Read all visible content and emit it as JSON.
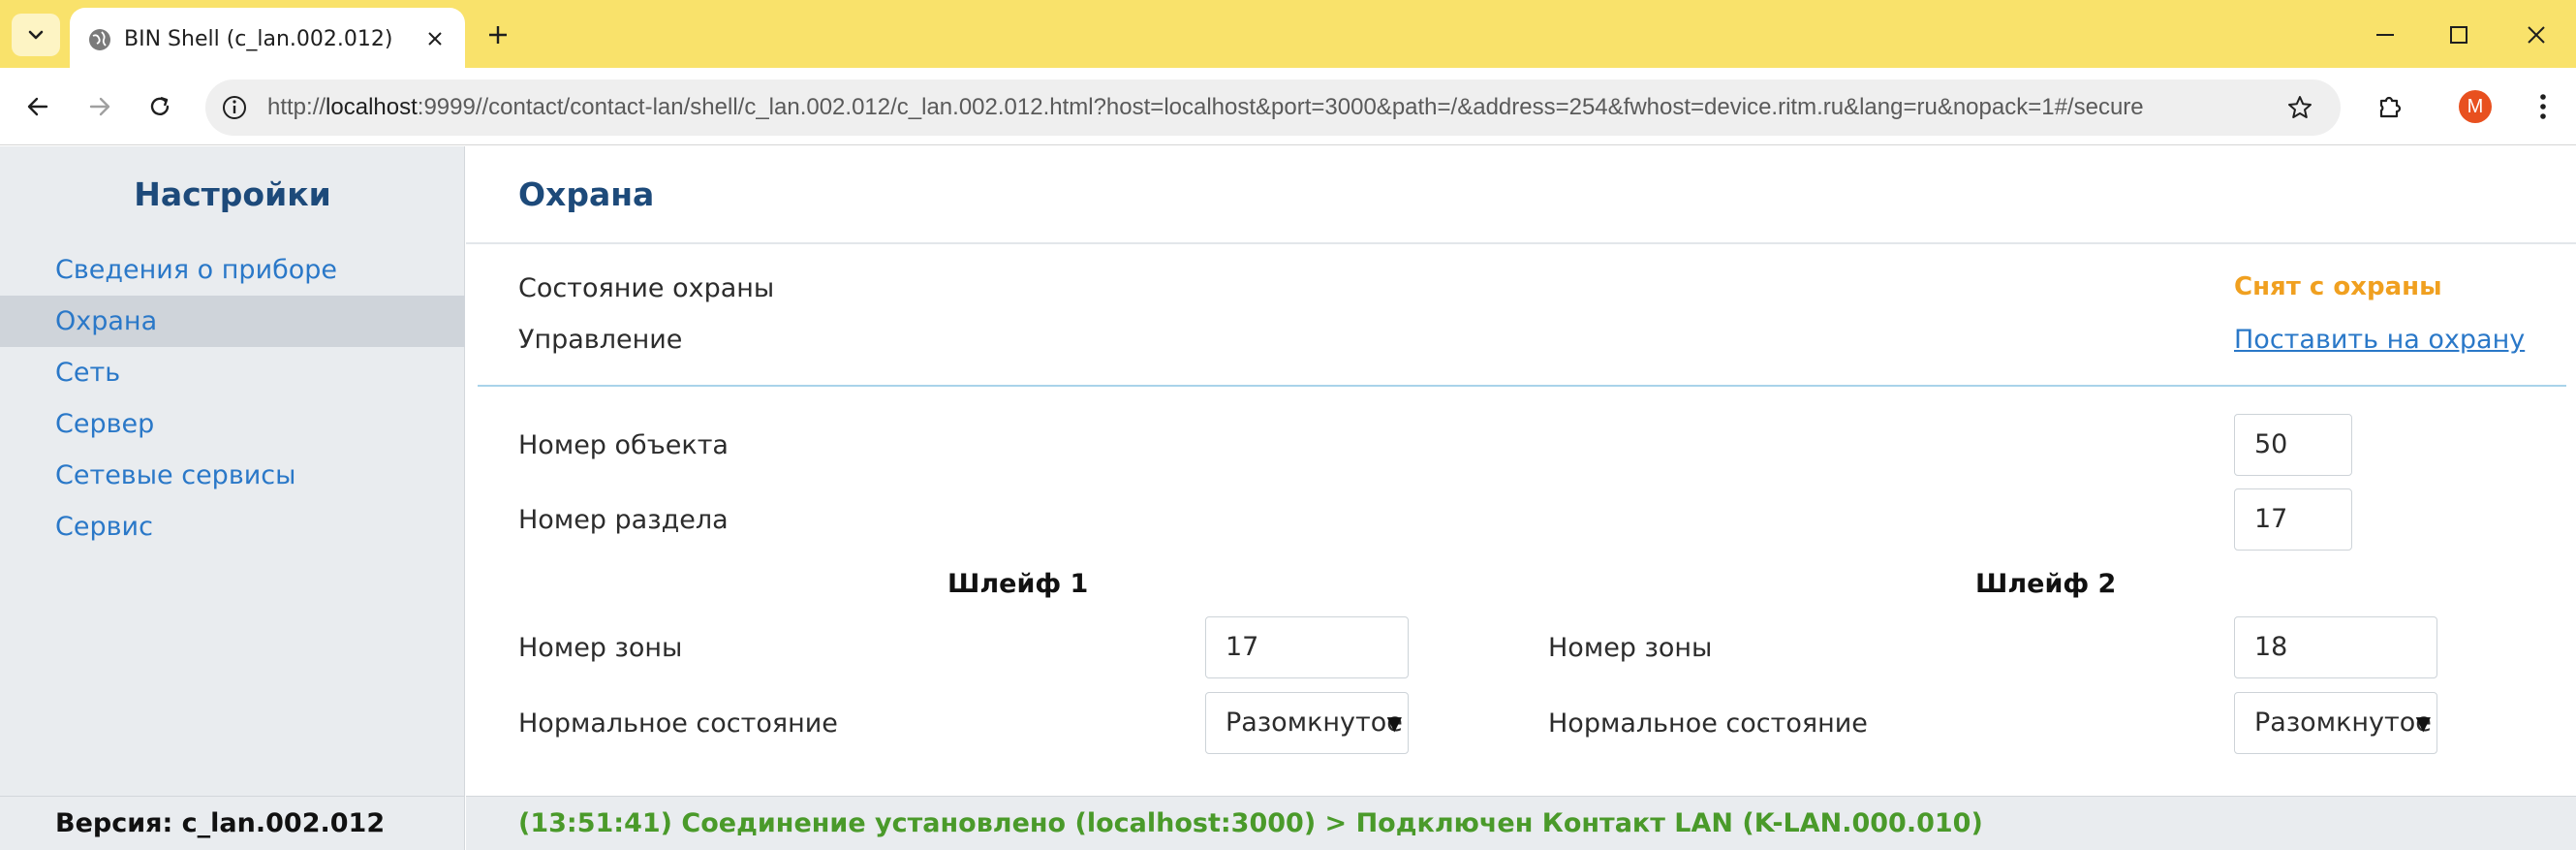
{
  "browser": {
    "tab_title": "BIN Shell (c_lan.002.012)",
    "url_prefix": "http://",
    "url_host": "localhost",
    "url_rest": ":9999//contact/contact-lan/shell/c_lan.002.012/c_lan.002.012.html?host=localhost&port=3000&path=/&address=254&fwhost=device.ritm.ru&lang=ru&nopack=1#/secure",
    "profile_initial": "M"
  },
  "sidebar": {
    "title": "Настройки",
    "items": [
      {
        "label": "Сведения о приборе"
      },
      {
        "label": "Охрана"
      },
      {
        "label": "Сеть"
      },
      {
        "label": "Сервер"
      },
      {
        "label": "Сетевые сервисы"
      },
      {
        "label": "Сервис"
      }
    ],
    "active_index": 1,
    "version": "Версия: c_lan.002.012"
  },
  "main": {
    "title": "Охрана",
    "security_state_label": "Состояние охраны",
    "security_state_value": "Снят с охраны",
    "control_label": "Управление",
    "control_link": "Поставить на охрану",
    "object_number_label": "Номер объекта",
    "object_number_value": "50",
    "partition_number_label": "Номер раздела",
    "partition_number_value": "17",
    "loops": [
      {
        "title": "Шлейф 1",
        "zone_label": "Номер зоны",
        "zone_value": "17",
        "normal_state_label": "Нормальное состояние",
        "normal_state_value": "Разомкнутое"
      },
      {
        "title": "Шлейф 2",
        "zone_label": "Номер зоны",
        "zone_value": "18",
        "normal_state_label": "Нормальное состояние",
        "normal_state_value": "Разомкнутое"
      }
    ]
  },
  "status_bar": {
    "message": "(13:51:41) Соединение установлено (localhost:3000) > Подключен Контакт LAN (K-LAN.000.010)"
  },
  "colors": {
    "tab_strip": "#f9e26b",
    "heading": "#1d4a7a",
    "link": "#2a78c8",
    "status_disarmed": "#f0a020",
    "status_ok": "#4a9a2a"
  }
}
